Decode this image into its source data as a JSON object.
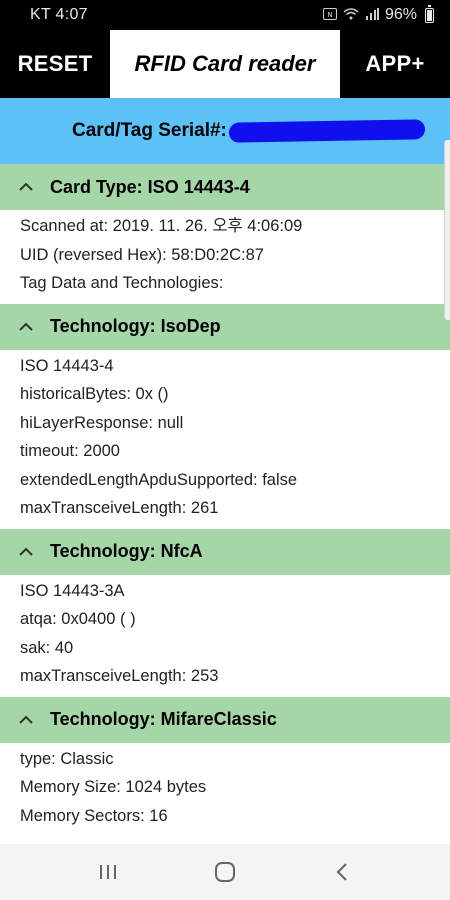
{
  "status_bar": {
    "carrier_time": "KT 4:07",
    "battery_percent": "96%"
  },
  "toolbar": {
    "reset_label": "RESET",
    "title": "RFID Card reader",
    "app_label": "APP+"
  },
  "serial": {
    "label": "Card/Tag Serial#:"
  },
  "sections": [
    {
      "title": "Card Type: ISO 14443-4",
      "lines": [
        "Scanned at: 2019. 11. 26. 오후 4:06:09",
        "UID (reversed Hex): 58:D0:2C:87",
        "Tag Data and Technologies:"
      ]
    },
    {
      "title": "Technology: IsoDep",
      "lines": [
        "ISO 14443-4",
        "historicalBytes: 0x ()",
        "hiLayerResponse: null",
        "timeout: 2000",
        "extendedLengthApduSupported: false",
        "maxTransceiveLength: 261"
      ]
    },
    {
      "title": "Technology: NfcA",
      "lines": [
        "ISO 14443-3A",
        "atqa: 0x0400 ( )",
        "sak: 40",
        "maxTransceiveLength: 253"
      ]
    },
    {
      "title": "Technology: MifareClassic",
      "lines": [
        "type: Classic",
        "Memory Size: 1024 bytes",
        "Memory Sectors: 16"
      ]
    }
  ],
  "icons": {
    "section_toggle": "chevron-up-icon",
    "nav_recents": "recents-icon",
    "nav_home": "home-icon",
    "nav_back": "back-icon"
  },
  "colors": {
    "serial_bar": "#5bc1f7",
    "section_header": "#a5d6a7",
    "toolbar": "#000000"
  }
}
